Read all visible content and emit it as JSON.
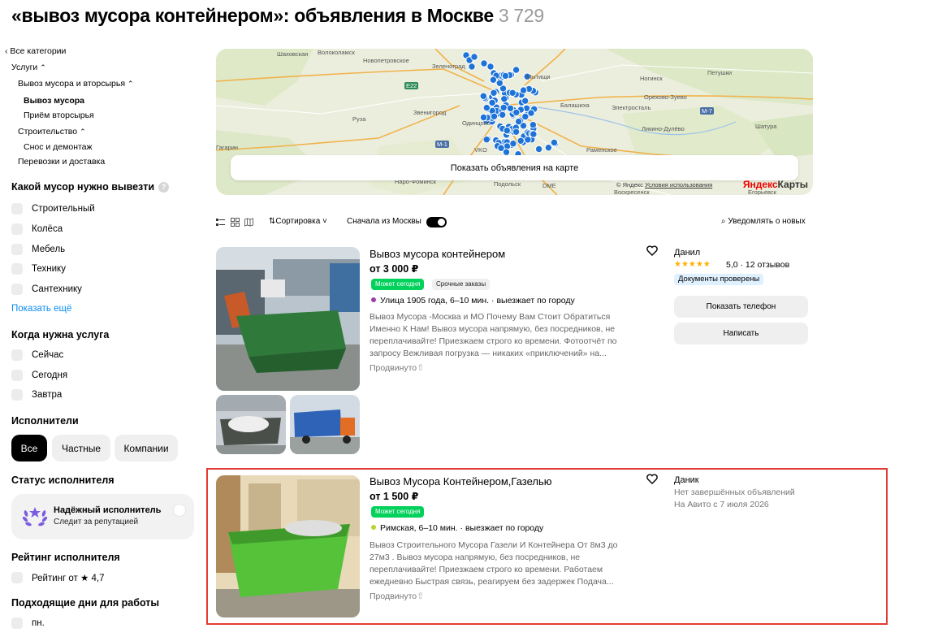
{
  "header": {
    "title": "«вывоз мусора контейнером»: объявления в Москве",
    "count": "3 729"
  },
  "sidebar": {
    "all_categories": "Все категории",
    "categories": [
      {
        "label": "Услуги"
      },
      {
        "label": "Вывоз мусора и вторсырья"
      },
      {
        "label": "Вывоз мусора"
      },
      {
        "label": "Приём вторсырья"
      },
      {
        "label": "Строительство"
      },
      {
        "label": "Снос и демонтаж"
      },
      {
        "label": "Перевозки и доставка"
      }
    ],
    "waste": {
      "title": "Какой мусор нужно вывезти",
      "options": [
        "Строительный",
        "Колёса",
        "Мебель",
        "Технику",
        "Сантехнику"
      ],
      "show_more": "Показать ещё"
    },
    "when": {
      "title": "Когда нужна услуга",
      "options": [
        "Сейчас",
        "Сегодня",
        "Завтра"
      ]
    },
    "performers": {
      "title": "Исполнители",
      "options": [
        "Все",
        "Частные",
        "Компании"
      ],
      "selected": "Все"
    },
    "status": {
      "title": "Статус исполнителя",
      "reliable_title": "Надёжный исполнитель",
      "reliable_sub": "Следит за репутацией"
    },
    "rating": {
      "title": "Рейтинг исполнителя",
      "option": "Рейтинг от ★ 4,7"
    },
    "days": {
      "title": "Подходящие дни для работы",
      "option": "пн."
    }
  },
  "map": {
    "labels": [
      "Шаховская",
      "Волоколамск",
      "Новопетровское",
      "Зеленоград",
      "Мытищи",
      "Ногинск",
      "Петушки",
      "Балашиха",
      "Орехово-Зуево",
      "Электросталь",
      "Руза",
      "Звенигород",
      "Одинцово",
      "Ликино-Дулёво",
      "Шатура",
      "Раменское",
      "Гагарин",
      "Подольск",
      "Воскресенск",
      "Егорьевск",
      "Наро-Фоминск",
      "DME",
      "VKO",
      "E22",
      "M-1",
      "M-7"
    ],
    "show_on_map": "Показать объявления на карте",
    "copyright": "© Яндекс",
    "terms": "Условия использования",
    "logo_a": "Яндекс",
    "logo_b": "Карты"
  },
  "toolbar": {
    "sort": "Сортировка",
    "moscow_first": "Сначала из Москвы",
    "notify": "Уведомлять о новых"
  },
  "listings": [
    {
      "title": "Вывоз мусора контейнером",
      "price": "от 3 000 ₽",
      "tags": [
        "Может сегодня",
        "Срочные заказы"
      ],
      "metro": "Улица 1905 года, 6–10 мин.",
      "travel": "выезжает по городу",
      "metro_color": "#9c3fa5",
      "description_lines": [
        "Вывоз Мусора -Москва и МО  Почему Вам Стоит Обратиться",
        "Именно К Нам!  Вывоз мусора напрямую, без посредников, не",
        "переплачивайте! Приезжаем строго ко времени. Фотоотчёт по",
        "запросу  Вежливая погрузка — никаких «приключений» на..."
      ],
      "promoted": "Продвинуто",
      "seller": {
        "name": "Данил",
        "stars": "★★★★★",
        "rating": "5,0 · 12 отзывов",
        "badge": "Документы проверены",
        "btn_phone": "Показать телефон",
        "btn_write": "Написать"
      }
    },
    {
      "title": "Вывоз Мусора Контейнером,Газелью",
      "price": "от 1 500 ₽",
      "tags": [
        "Может сегодня"
      ],
      "metro": "Римская, 6–10 мин.",
      "travel": "выезжает по городу",
      "metro_color": "#b6d530",
      "description_lines": [
        "Вывоз Строительного Мусора Газели И Контейнера От 8м3 до",
        "27м3 . Вывоз мусора напрямую, без посредников, не",
        "переплачивайте! Приезжаем строго ко времени. Работаем",
        "ежедневно  Быстрая связь, реагируем без задержек  Подача..."
      ],
      "promoted": "Продвинуто",
      "seller": {
        "name": "Даник",
        "meta1": "Нет завершённых объявлений",
        "meta2": "На Авито с 7 июля 2026"
      }
    }
  ],
  "colors": {
    "accent": "#0a8cf0",
    "green": "#02d15c",
    "highlight": "#e53935",
    "map_marker": "#1e73d8"
  }
}
